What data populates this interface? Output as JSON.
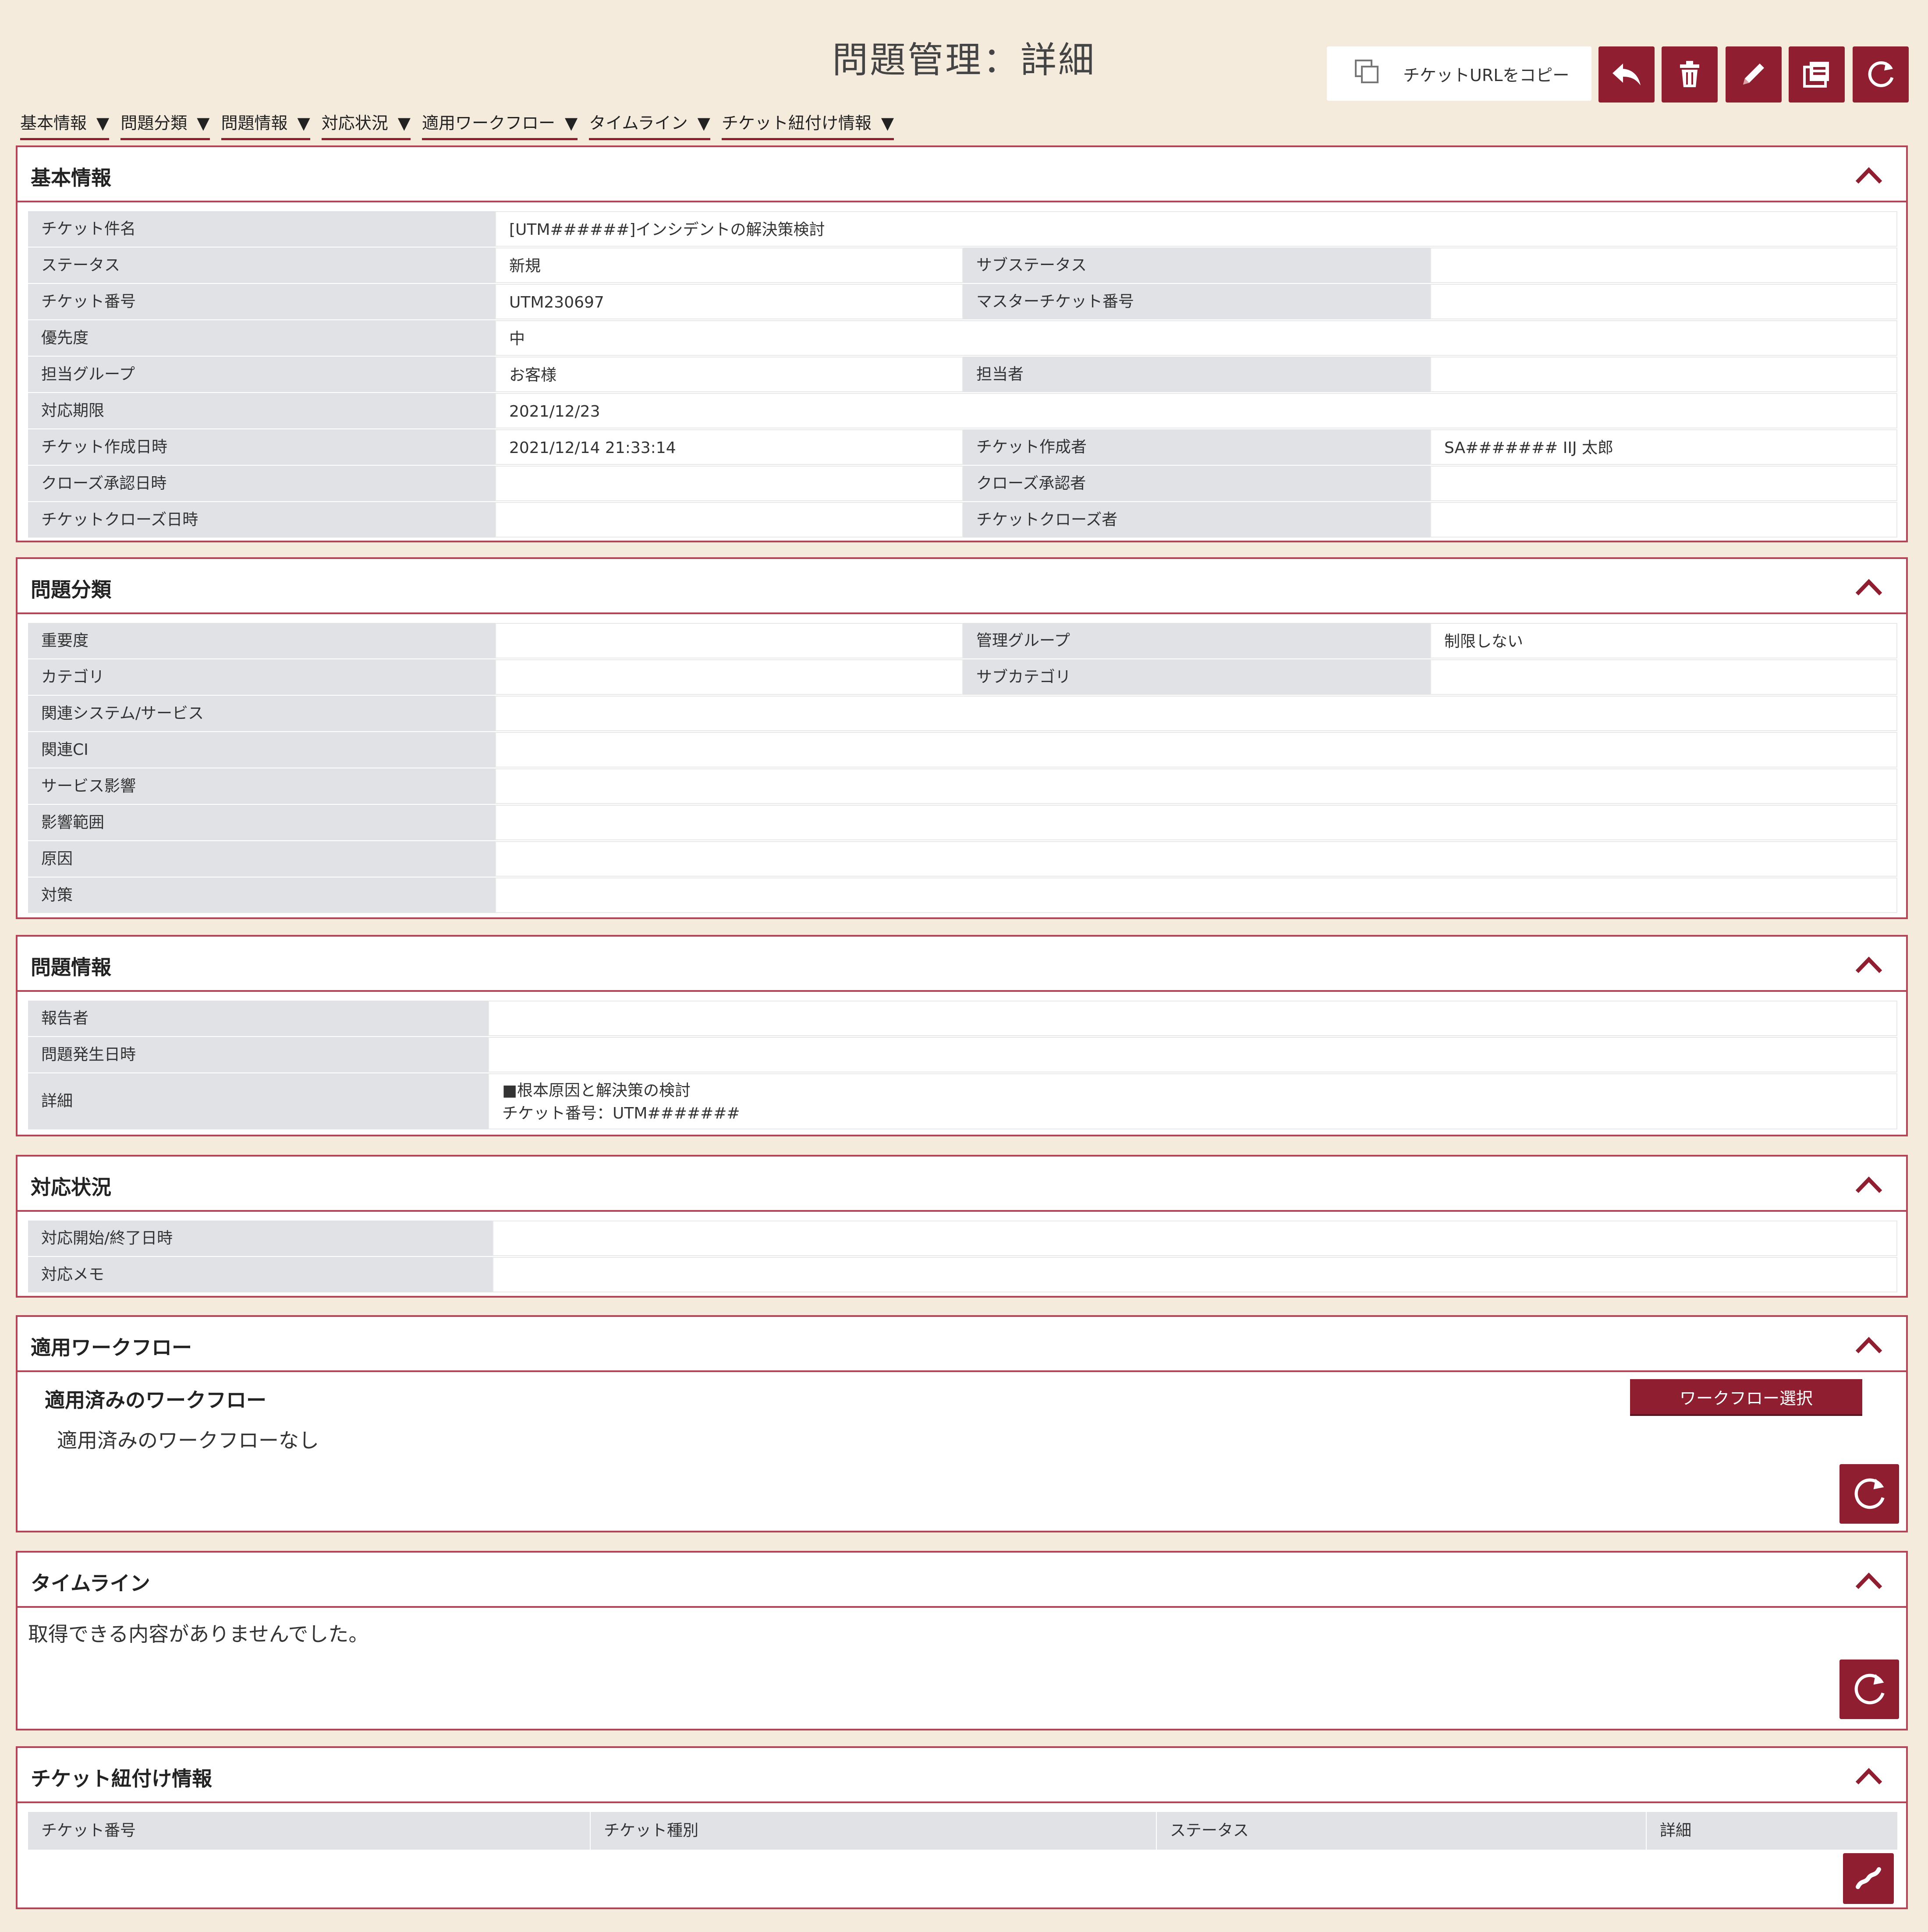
{
  "header": {
    "title": "問題管理：詳細",
    "copy_url_label": "チケットURLをコピー"
  },
  "toolbar": {
    "icons": [
      "reply-icon",
      "trash-icon",
      "pencil-icon",
      "copy-ticket-icon",
      "refresh-icon"
    ]
  },
  "anchors": [
    {
      "label": "基本情報",
      "arrow": "▼"
    },
    {
      "label": "問題分類",
      "arrow": "▼"
    },
    {
      "label": "問題情報",
      "arrow": "▼"
    },
    {
      "label": "対応状況",
      "arrow": "▼"
    },
    {
      "label": "適用ワークフロー",
      "arrow": "▼"
    },
    {
      "label": "タイムライン",
      "arrow": "▼"
    },
    {
      "label": "チケット紐付け情報",
      "arrow": "▼"
    }
  ],
  "basic": {
    "title": "基本情報",
    "ticket_name_label": "チケット件名",
    "ticket_name": "[UTM######]インシデントの解決策検討",
    "status_label": "ステータス",
    "status": "新規",
    "substatus_label": "サブステータス",
    "substatus": "",
    "ticket_no_label": "チケット番号",
    "ticket_no": "UTM230697",
    "master_no_label": "マスターチケット番号",
    "master_no": "",
    "priority_label": "優先度",
    "priority": "中",
    "group_label": "担当グループ",
    "group": "お客様",
    "assignee_label": "担当者",
    "assignee": "",
    "deadline_label": "対応期限",
    "deadline": "2021/12/23",
    "created_at_label": "チケット作成日時",
    "created_at": "2021/12/14 21:33:14",
    "creator_label": "チケット作成者",
    "creator": "SA####### IIJ 太郎",
    "close_approved_at_label": "クローズ承認日時",
    "close_approved_at": "",
    "close_approver_label": "クローズ承認者",
    "close_approver": "",
    "closed_at_label": "チケットクローズ日時",
    "closed_at": "",
    "closer_label": "チケットクローズ者",
    "closer": ""
  },
  "classification": {
    "title": "問題分類",
    "severity_label": "重要度",
    "severity": "",
    "mgmt_group_label": "管理グループ",
    "mgmt_group": "制限しない",
    "category_label": "カテゴリ",
    "category": "",
    "subcategory_label": "サブカテゴリ",
    "subcategory": "",
    "related_system_label": "関連システム/サービス",
    "related_system": "",
    "related_ci_label": "関連CI",
    "related_ci": "",
    "service_impact_label": "サービス影響",
    "service_impact": "",
    "impact_scope_label": "影響範囲",
    "impact_scope": "",
    "cause_label": "原因",
    "cause": "",
    "measure_label": "対策",
    "measure": ""
  },
  "problem_info": {
    "title": "問題情報",
    "reporter_label": "報告者",
    "reporter": "",
    "occurred_at_label": "問題発生日時",
    "occurred_at": "",
    "detail_label": "詳細",
    "detail_line1": "■根本原因と解決策の検討",
    "detail_line2": "チケット番号：UTM#######"
  },
  "response": {
    "title": "対応状況",
    "period_label": "対応開始/終了日時",
    "period": "",
    "memo_label": "対応メモ",
    "memo": ""
  },
  "workflow": {
    "title": "適用ワークフロー",
    "subtitle": "適用済みのワークフロー",
    "empty": "適用済みのワークフローなし",
    "select_label": "ワークフロー選択"
  },
  "timeline": {
    "title": "タイムライン",
    "empty": "取得できる内容がありませんでした。"
  },
  "links": {
    "title": "チケット紐付け情報",
    "columns": [
      "チケット番号",
      "チケット種別",
      "ステータス",
      "詳細"
    ]
  },
  "colors": {
    "accent": "#8e1e30",
    "panel_border": "#b44556",
    "background": "#f4ebdc",
    "label_bg": "#e0e2e6"
  }
}
